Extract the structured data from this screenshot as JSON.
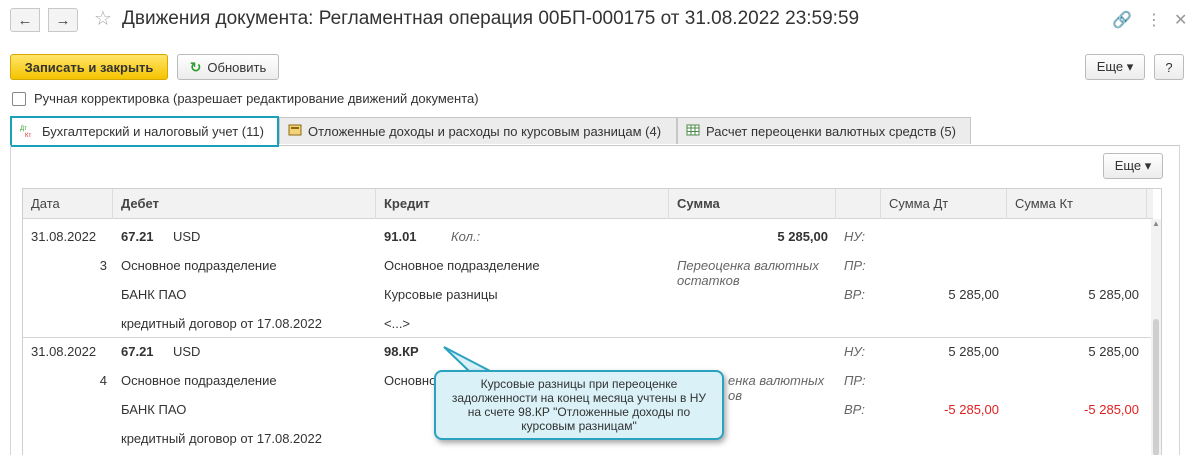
{
  "window": {
    "title": "Движения документа: Регламентная операция 00БП-000175 от 31.08.2022 23:59:59",
    "back_glyph": "←",
    "forward_glyph": "→",
    "star_glyph": "☆",
    "link_glyph": "🔗",
    "more_glyph": "⋮",
    "close_glyph": "✕"
  },
  "toolbar": {
    "save_close_label": "Записать и закрыть",
    "refresh_label": "Обновить",
    "refresh_glyph": "↻",
    "more_label": "Еще ▾",
    "help_label": "?"
  },
  "manual_edit": {
    "label": "Ручная корректировка (разрешает редактирование движений документа)",
    "checked": false
  },
  "tabs": [
    {
      "label": "Бухгалтерский и налоговый учет (11)",
      "icon": "ДтКт",
      "active": true
    },
    {
      "label": "Отложенные доходы и расходы по курсовым разницам (4)",
      "icon": "register-icon",
      "active": false
    },
    {
      "label": "Расчет переоценки валютных средств (5)",
      "icon": "table-icon",
      "active": false
    }
  ],
  "grid_toolbar": {
    "more_label": "Еще ▾"
  },
  "columns": {
    "date": "Дата",
    "debit": "Дебет",
    "credit": "Кредит",
    "sum": "Сумма",
    "sum_dt": "Сумма Дт",
    "sum_kt": "Сумма Кт"
  },
  "records": [
    {
      "date": "31.08.2022",
      "num": "3",
      "debit_account": "67.21",
      "debit_currency": "USD",
      "debit_sub1": "Основное подразделение",
      "debit_sub2": "БАНК ПАО",
      "debit_sub3": "кредитный договор от 17.08.2022",
      "credit_account": "91.01",
      "credit_qty_label": "Кол.:",
      "credit_sub1": "Основное подразделение",
      "credit_sub2": "Курсовые разницы",
      "credit_sub3": "<...>",
      "sum": "5 285,00",
      "content": "Переоценка валютных остатков",
      "nu_label": "НУ:",
      "pr_label": "ПР:",
      "vr_label": "ВР:",
      "nu_dt": "",
      "nu_kt": "",
      "vr_dt": "5 285,00",
      "vr_kt": "5 285,00"
    },
    {
      "date": "31.08.2022",
      "num": "4",
      "debit_account": "67.21",
      "debit_currency": "USD",
      "debit_sub1": "Основное подразделение",
      "debit_sub2": "БАНК ПАО",
      "debit_sub3": "кредитный договор от 17.08.2022",
      "credit_account": "98.КР",
      "credit_sub1": "Основно",
      "content_partial_1": "енка валютных",
      "content_partial_2": "ов",
      "nu_label": "НУ:",
      "pr_label": "ПР:",
      "vr_label": "ВР:",
      "nu_dt": "5 285,00",
      "nu_kt": "5 285,00",
      "vr_dt": "-5 285,00",
      "vr_kt": "-5 285,00"
    }
  ],
  "callout": {
    "text": "Курсовые разницы при переоценке задолженности на конец месяца учтены в НУ на счете 98.КР \"Отложенные доходы по курсовым разницам\""
  },
  "colors": {
    "accent": "#1aa0b8",
    "primary_button": "#f5c400",
    "negative": "#e02020",
    "callout_bg": "#d9f1f7"
  }
}
